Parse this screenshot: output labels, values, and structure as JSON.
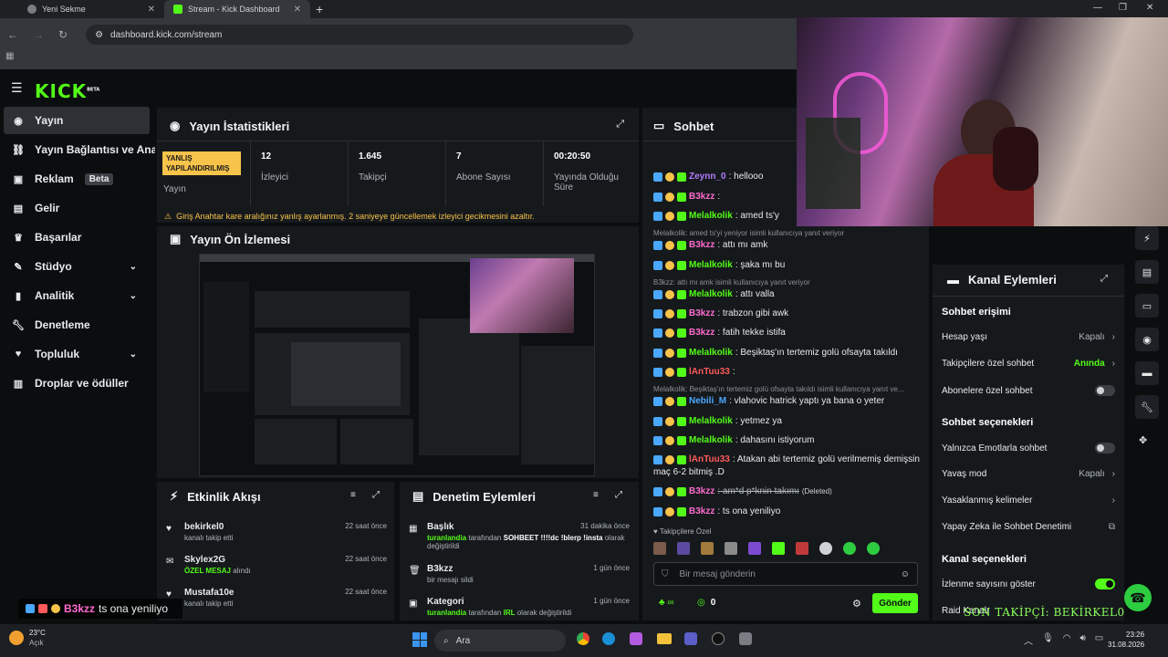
{
  "browser": {
    "tabs": [
      {
        "label": "Yeni Sekme"
      },
      {
        "label": "Stream - Kick Dashboard"
      }
    ],
    "url": "dashboard.kick.com/stream"
  },
  "app": {
    "logo": "KICK",
    "logo_badge": "BETA"
  },
  "sidebar": {
    "items": [
      {
        "label": "Yayın",
        "icon": "stream-icon"
      },
      {
        "label": "Yayın Bağlantısı ve Anahtarı",
        "icon": "link-icon"
      },
      {
        "label": "Reklam",
        "badge": "Beta",
        "icon": "ad-icon"
      },
      {
        "label": "Gelir",
        "icon": "revenue-icon"
      },
      {
        "label": "Başarılar",
        "icon": "trophy-icon"
      },
      {
        "label": "Stüdyo",
        "icon": "studio-icon"
      },
      {
        "label": "Analitik",
        "icon": "analytics-icon"
      },
      {
        "label": "Denetleme",
        "icon": "wrench-icon"
      },
      {
        "label": "Topluluk",
        "icon": "community-icon"
      },
      {
        "label": "Droplar ve ödüller",
        "icon": "gift-icon"
      }
    ]
  },
  "stats": {
    "title": "Yayın İstatistikleri",
    "status_badge": "YANLIŞ YAPILANDIRILMIŞ",
    "status_label": "Yayın",
    "viewers_value": "12",
    "viewers_label": "İzleyici",
    "followers_value": "1.645",
    "followers_label": "Takipçi",
    "subs_value": "7",
    "subs_label": "Abone Sayısı",
    "uptime_value": "00:20:50",
    "uptime_label": "Yayında Olduğu Süre",
    "warning": "Giriş Anahtar kare aralığınız yanlış ayarlanmış. 2 saniyeye güncellemek izleyici gecikmesini azaltır."
  },
  "preview": {
    "title": "Yayın Ön İzlemesi"
  },
  "chat": {
    "title": "Sohbet",
    "lines": [
      {
        "user": "Zeynn_0",
        "color": "#b17cff",
        "text": ": hellooo"
      },
      {
        "user": "B3kzz",
        "color": "#ff6bd0",
        "text": ":"
      },
      {
        "user": "Melalkolik",
        "color": "#53fc18",
        "text": ": amed ts'y"
      },
      {
        "reply": "Melalkolik: amed ts'yi yeniyor isimli kullanıcıya yanıt veriyor"
      },
      {
        "user": "B3kzz",
        "color": "#ff6bd0",
        "text": ": attı mı amk"
      },
      {
        "user": "Melalkolik",
        "color": "#53fc18",
        "text": ": şaka mı bu"
      },
      {
        "reply": "B3kzz: attı mı amk isimli kullanıcıya yanıt veriyor"
      },
      {
        "user": "Melalkolik",
        "color": "#53fc18",
        "text": ": attı valla"
      },
      {
        "user": "B3kzz",
        "color": "#ff6bd0",
        "text": ": trabzon gibi awk"
      },
      {
        "user": "B3kzz",
        "color": "#ff6bd0",
        "text": ": fatih tekke istifa"
      },
      {
        "user": "Melalkolik",
        "color": "#53fc18",
        "text": ": Beşiktaş'ın tertemiz golü ofsayta takıldı"
      },
      {
        "user": "lAnTuu33",
        "color": "#ff5a5a",
        "text": ":"
      },
      {
        "reply": "Melalkolik: Beşiktaş'ın tertemiz golü ofsayta takıldı isimli kullanıcıya yanıt ve..."
      },
      {
        "user": "Nebili_M",
        "color": "#4aa8ff",
        "text": ": vlahovic hatrick yaptı ya bana o yeter"
      },
      {
        "user": "Melalkolik",
        "color": "#53fc18",
        "text": ": yetmez ya"
      },
      {
        "user": "Melalkolik",
        "color": "#53fc18",
        "text": ": dahasını istiyorum"
      },
      {
        "user": "lAnTuu33",
        "color": "#ff5a5a",
        "text": ": Atakan abi tertemiz golü verilmemiş demişsin"
      },
      {
        "cont": "maç 6-2 bitmiş .D"
      },
      {
        "user": "B3kzz",
        "color": "#ff6bd0",
        "text": ": am*d p*knin takımı",
        "deleted": "(Deleted)"
      },
      {
        "user": "B3kzz",
        "color": "#ff6bd0",
        "text": ": ts ona yeniliyo"
      }
    ],
    "followers_only": "Takipçilere Özel",
    "input_placeholder": "Bir mesaj gönderin",
    "points": "0",
    "send_label": "Gönder"
  },
  "channel_actions": {
    "title": "Kanal Eylemleri",
    "chat_access": "Sohbet erişimi",
    "account_age": "Hesap yaşı",
    "account_age_val": "Kapalı",
    "follower_chat": "Takipçilere özel sohbet",
    "follower_chat_val": "Anında",
    "sub_chat": "Abonelere özel sohbet",
    "chat_options": "Sohbet seçenekleri",
    "emote_only": "Yalnızca Emotlarla sohbet",
    "slow_mode": "Yavaş mod",
    "slow_mode_val": "Kapalı",
    "banned_words": "Yasaklanmış kelimeler",
    "ai_mod": "Yapay Zeka ile Sohbet Denetimi",
    "channel_options": "Kanal seçenekleri",
    "show_viewers": "İzlenme sayısını göster",
    "raid": "Raid Kanalı"
  },
  "activity": {
    "title": "Etkinlik Akışı",
    "items": [
      {
        "user": "bekirkel0",
        "sub": "kanalı takip etti",
        "time": "22 saat önce"
      },
      {
        "user": "Skylex2G",
        "sub_hl": "ÖZEL MESAJ",
        "sub": " alındı",
        "time": "22 saat önce"
      },
      {
        "user": "Mustafa10e",
        "sub": "kanalı takip etti",
        "time": "22 saat önce"
      }
    ]
  },
  "moderation": {
    "title": "Denetim Eylemleri",
    "items": [
      {
        "title": "Başlık",
        "by": "turanlandia",
        "mid": " tarafından ",
        "hl": "SOHBEET !!!!dc !blerp !insta",
        "tail": " olarak değiştirildi",
        "time": "31 dakika önce"
      },
      {
        "title": "B3kzz",
        "sub": "bir mesajı sildi",
        "time": "1 gün önce"
      },
      {
        "title": "Kategori",
        "by": "turanlandia",
        "mid": " tarafından ",
        "hl": "IRL",
        "tail": " olarak değiştirildi",
        "time": "1 gün önce"
      }
    ]
  },
  "overlay": {
    "chat_user": "B3kzz",
    "chat_text": "ts ona yeniliyo",
    "last_follower": "SON TAKİPÇİ: BEKİRKEL0"
  },
  "taskbar": {
    "weather_temp": "23°C",
    "weather_desc": "Açık",
    "search": "Ara",
    "time": "23:26",
    "date": "31.08.2026"
  }
}
